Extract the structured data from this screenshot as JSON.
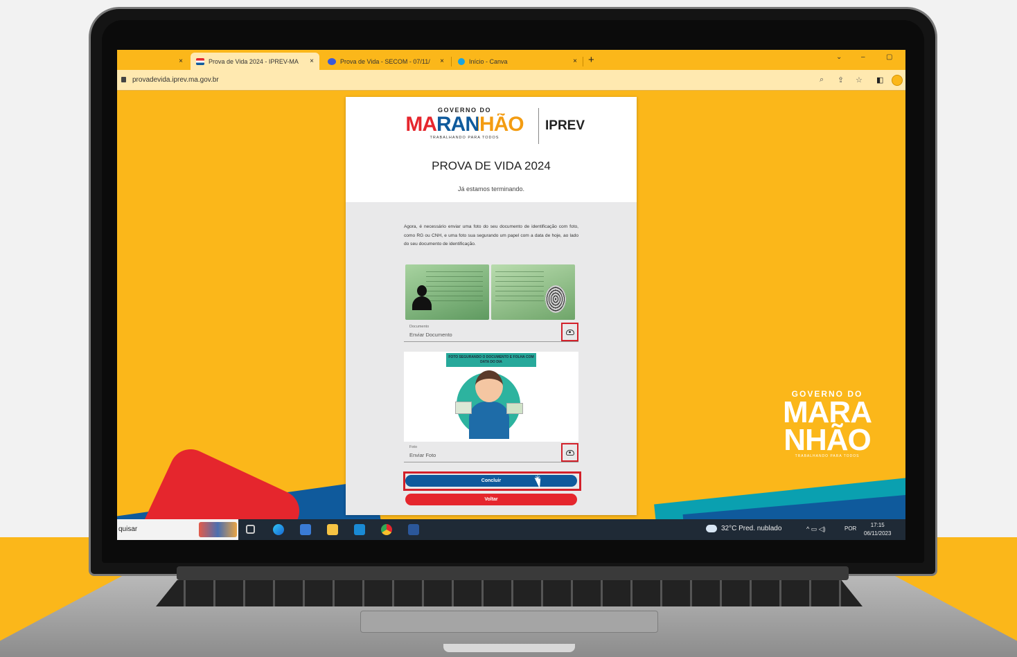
{
  "browser": {
    "tabs": [
      {
        "label": "",
        "close": "×"
      },
      {
        "label": "Prova de Vida 2024 - IPREV-MA",
        "close": "×"
      },
      {
        "label": "Prova de Vida - SECOM - 07/11/",
        "close": "×"
      },
      {
        "label": "Início - Canva",
        "close": "×"
      }
    ],
    "new_tab": "+",
    "window_controls": {
      "dropdown": "⌄",
      "minimize": "–",
      "maximize": "▢"
    },
    "url": "provadevida.iprev.ma.gov.br"
  },
  "page": {
    "logo": {
      "top": "GOVERNO DO",
      "main": "MARANHÃO",
      "tagline": "TRABALHANDO PARA TODOS"
    },
    "iprev": "IPREV",
    "title": "PROVA DE VIDA 2024",
    "subtitle": "Já estamos terminando.",
    "instructions": "Agora, é necessário enviar uma foto do seu documento de identificação com foto, como RG ou CNH, e uma foto sua segurando um papel com a data de hoje, ao lado do seu documento de identificação.",
    "document_field": {
      "label": "Documento",
      "value": "Enviar Documento"
    },
    "photo_banner": "FOTO SEGURANDO O DOCUMENTO E FOLHA COM DATA DO DIA",
    "photo_field": {
      "label": "Foto",
      "value": "Enviar Foto"
    },
    "buttons": {
      "concluir": "Concluir",
      "voltar": "Voltar"
    }
  },
  "watermark": {
    "top": "GOVERNO DO",
    "line1": "MARA",
    "line2": "NHÃO",
    "tagline": "TRABALHANDO PARA TODOS"
  },
  "taskbar": {
    "search": "quisar",
    "weather": "32°C  Pred. nublado",
    "lang": "POR",
    "time": "17:15",
    "date": "06/11/2023"
  },
  "colors": {
    "brand_yellow": "#fbb71a",
    "brand_blue": "#0f5a9c",
    "brand_red": "#e5262d",
    "highlight": "#d2202a"
  }
}
